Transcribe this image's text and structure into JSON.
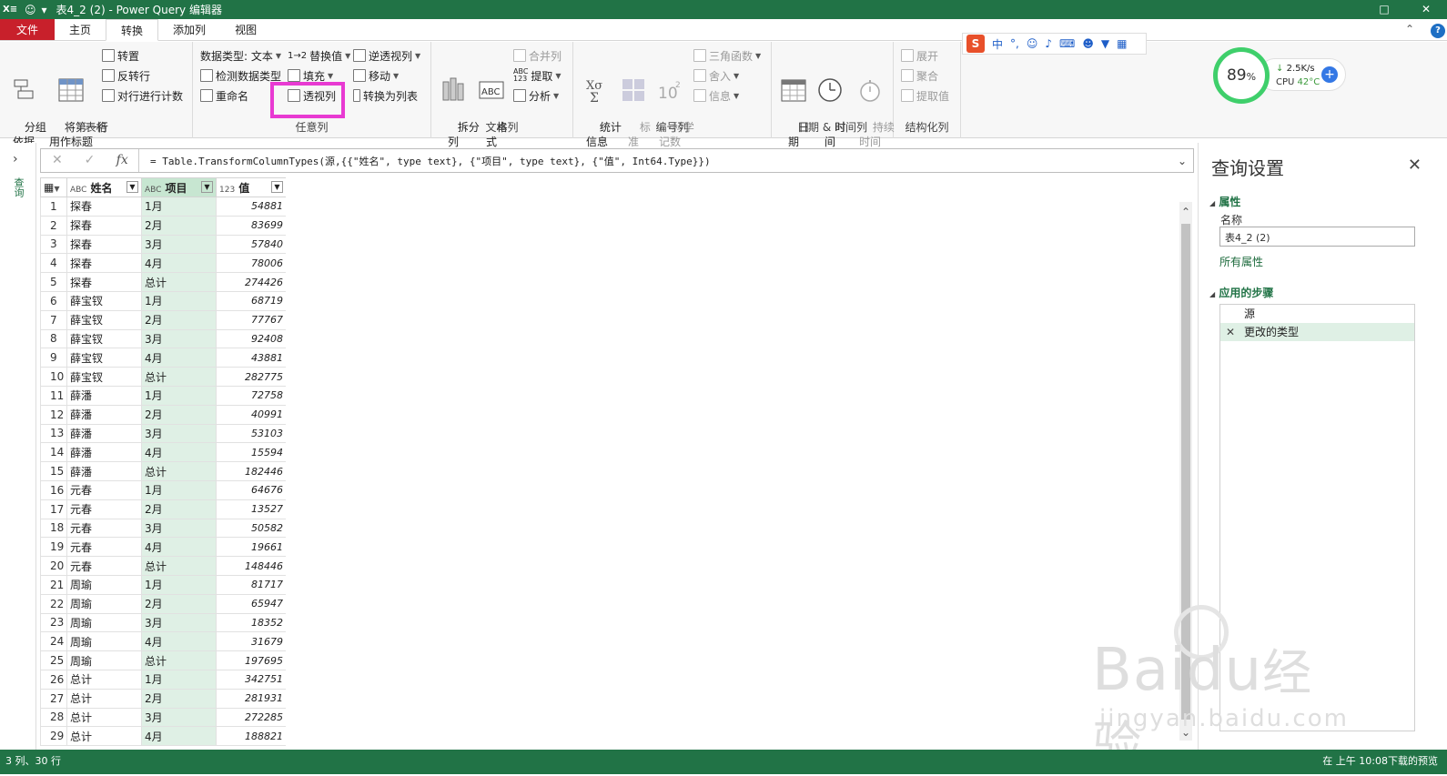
{
  "titlebar": {
    "app_icon": "X≡",
    "title": "表4_2 (2) - Power Query 编辑器",
    "restore_icon": "□",
    "close_icon": "✕"
  },
  "tabs": [
    {
      "label": "文件"
    },
    {
      "label": "主页"
    },
    {
      "label": "转换"
    },
    {
      "label": "添加列"
    },
    {
      "label": "视图"
    }
  ],
  "ribbon": {
    "table_group": {
      "label": "表格",
      "group_by": "分组\n依据",
      "first_row_header": "将第一行\n用作标题",
      "transpose": "转置",
      "reverse_rows": "反转行",
      "count_rows": "对行进行计数"
    },
    "any_column_group": {
      "label": "任意列",
      "data_type": "数据类型: 文本",
      "detect_type": "检测数据类型",
      "rename": "重命名",
      "replace_values": "替换值",
      "fill": "填充",
      "pivot_column": "透视列",
      "unpivot_columns": "逆透视列",
      "move": "移动",
      "convert_to_list": "转换为列表"
    },
    "text_group": {
      "label": "文本列",
      "split": "拆分\n列",
      "format": "格\n式",
      "merge": "合并列",
      "extract": "提取",
      "parse": "分析"
    },
    "number_group": {
      "label": "编号列",
      "statistics": "统计\n信息",
      "standard": "标\n准",
      "scientific": "科学\n记数",
      "trig": "三角函数",
      "rounding": "舍入",
      "info": "信息"
    },
    "datetime_group": {
      "label": "日期 & 时间列",
      "date": "日\n期",
      "time": "时\n间",
      "duration": "持续\n时间"
    },
    "structured_group": {
      "label": "结构化列",
      "expand": "展开",
      "aggregate": "聚合",
      "extract_values": "提取值"
    }
  },
  "ime": {
    "chinese": "中",
    "punct": "°,"
  },
  "perf": {
    "percent": "89",
    "unit": "%",
    "net": "2.5K/s",
    "cpu_label": "CPU",
    "cpu_temp": "42°C",
    "plus": "+"
  },
  "leftnav": {
    "label": "查询"
  },
  "formula": {
    "expression": "= Table.TransformColumnTypes(源,{{\"姓名\", type text}, {\"项目\", type text}, {\"值\", Int64.Type}})"
  },
  "grid": {
    "columns": [
      {
        "type": "ABC",
        "name": "姓名"
      },
      {
        "type": "ABC",
        "name": "项目"
      },
      {
        "type": "123",
        "name": "值"
      }
    ],
    "rows": [
      [
        "1",
        "探春",
        "1月",
        "54881"
      ],
      [
        "2",
        "探春",
        "2月",
        "83699"
      ],
      [
        "3",
        "探春",
        "3月",
        "57840"
      ],
      [
        "4",
        "探春",
        "4月",
        "78006"
      ],
      [
        "5",
        "探春",
        "总计",
        "274426"
      ],
      [
        "6",
        "薛宝钗",
        "1月",
        "68719"
      ],
      [
        "7",
        "薛宝钗",
        "2月",
        "77767"
      ],
      [
        "8",
        "薛宝钗",
        "3月",
        "92408"
      ],
      [
        "9",
        "薛宝钗",
        "4月",
        "43881"
      ],
      [
        "10",
        "薛宝钗",
        "总计",
        "282775"
      ],
      [
        "11",
        "薛潘",
        "1月",
        "72758"
      ],
      [
        "12",
        "薛潘",
        "2月",
        "40991"
      ],
      [
        "13",
        "薛潘",
        "3月",
        "53103"
      ],
      [
        "14",
        "薛潘",
        "4月",
        "15594"
      ],
      [
        "15",
        "薛潘",
        "总计",
        "182446"
      ],
      [
        "16",
        "元春",
        "1月",
        "64676"
      ],
      [
        "17",
        "元春",
        "2月",
        "13527"
      ],
      [
        "18",
        "元春",
        "3月",
        "50582"
      ],
      [
        "19",
        "元春",
        "4月",
        "19661"
      ],
      [
        "20",
        "元春",
        "总计",
        "148446"
      ],
      [
        "21",
        "周瑜",
        "1月",
        "81717"
      ],
      [
        "22",
        "周瑜",
        "2月",
        "65947"
      ],
      [
        "23",
        "周瑜",
        "3月",
        "18352"
      ],
      [
        "24",
        "周瑜",
        "4月",
        "31679"
      ],
      [
        "25",
        "周瑜",
        "总计",
        "197695"
      ],
      [
        "26",
        "总计",
        "1月",
        "342751"
      ],
      [
        "27",
        "总计",
        "2月",
        "281931"
      ],
      [
        "28",
        "总计",
        "3月",
        "272285"
      ],
      [
        "29",
        "总计",
        "4月",
        "188821"
      ]
    ]
  },
  "query_settings": {
    "title": "查询设置",
    "properties_label": "属性",
    "name_label": "名称",
    "name_value": "表4_2 (2)",
    "all_properties": "所有属性",
    "steps_label": "应用的步骤",
    "steps": [
      "源",
      "更改的类型"
    ]
  },
  "watermark": {
    "brand": "Bai",
    "brand_cn": "经验",
    "url": "jingyan.baidu.com"
  },
  "status": {
    "left": "3 列、30 行",
    "right": "在 上午 10:08下载的预览"
  }
}
